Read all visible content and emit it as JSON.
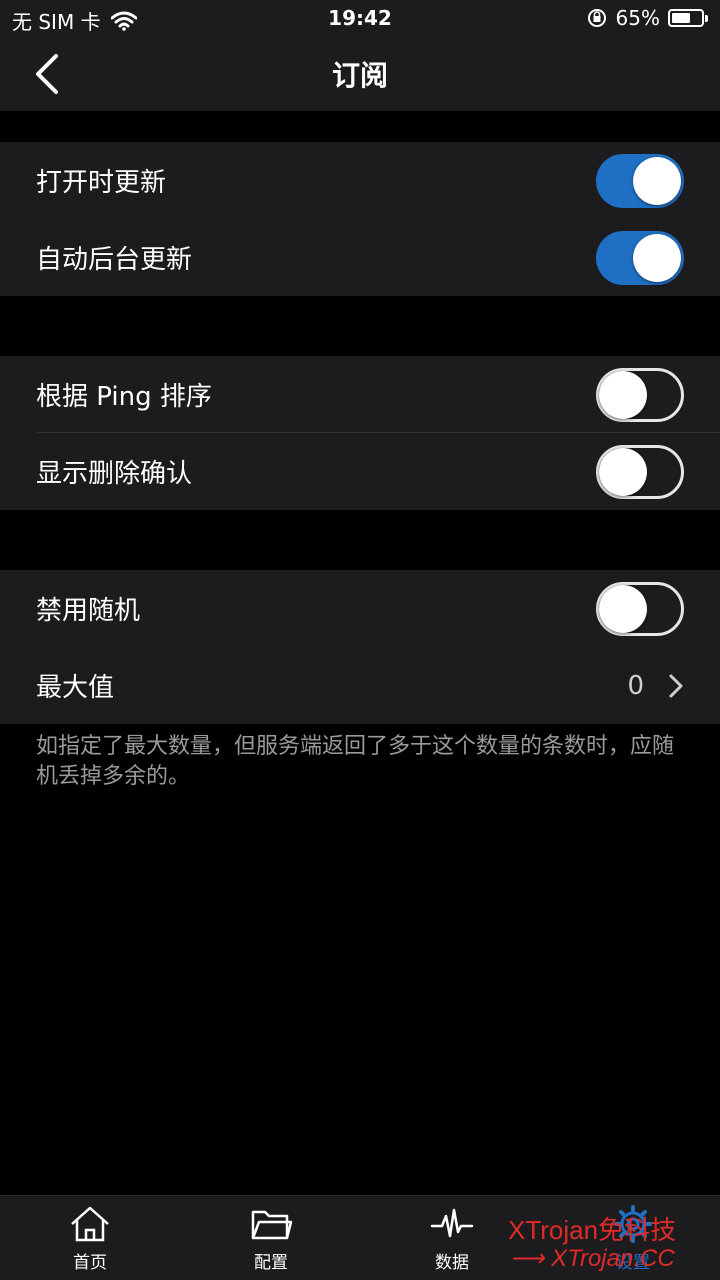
{
  "status_bar": {
    "carrier": "无 SIM 卡",
    "time": "19:42",
    "battery_percent": "65%",
    "battery_level": 0.65
  },
  "nav": {
    "title": "订阅",
    "back_icon": "chevron-left-icon"
  },
  "groups": [
    {
      "items": [
        {
          "label": "打开时更新",
          "toggle": true
        },
        {
          "label": "自动后台更新",
          "toggle": true
        }
      ]
    },
    {
      "items": [
        {
          "label": "根据 Ping 排序",
          "toggle": false
        },
        {
          "label": "显示删除确认",
          "toggle": false
        }
      ]
    },
    {
      "items": [
        {
          "label": "禁用随机",
          "toggle": false
        },
        {
          "label": "最大值",
          "value": "0"
        }
      ]
    }
  ],
  "footnote": "如指定了最大数量，但服务端返回了多于这个数量的条数时，应随机丢掉多余的。",
  "tabbar": {
    "tabs": [
      {
        "label": "首页",
        "icon": "home-icon"
      },
      {
        "label": "配置",
        "icon": "folder-icon"
      },
      {
        "label": "数据",
        "icon": "pulse-icon"
      },
      {
        "label": "设置",
        "icon": "gear-icon",
        "active": true
      }
    ]
  },
  "watermark": {
    "line1": "XTrojan免科技",
    "line2": "XTrojan.CC"
  },
  "colors": {
    "accent": "#1f6fc4",
    "background": "#000000",
    "cell": "#1c1c1e",
    "watermark": "#e02a2a"
  }
}
